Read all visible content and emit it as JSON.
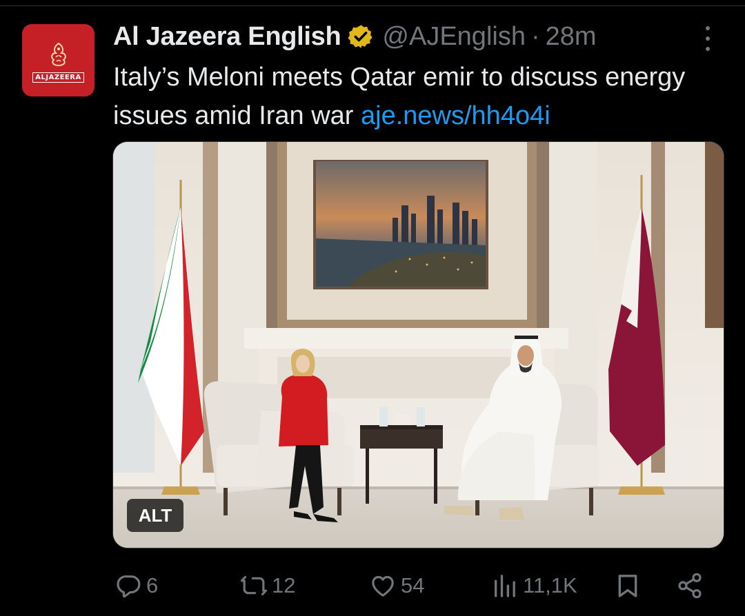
{
  "account": {
    "name": "Al Jazeera English",
    "handle": "@AJEnglish",
    "separator": "·",
    "time": "28m",
    "avatar_label": "ALJAZEERA",
    "avatar_color": "#c42026",
    "verified_icon": "verified-gold-badge-icon",
    "verified_color": "#e2b719"
  },
  "tweet": {
    "text": "Italy’s Meloni meets Qatar emir to discuss energy issues amid Iran war ",
    "link": "aje.news/hh4o4i",
    "link_color": "#1d9bf0"
  },
  "media": {
    "alt_badge": "ALT"
  },
  "actions": {
    "replies": "6",
    "reposts": "12",
    "likes": "54",
    "views": "11,1K"
  },
  "icons": {
    "reply": "reply-bubble-icon",
    "repost": "repost-arrows-icon",
    "like": "heart-icon",
    "views": "views-bar-chart-icon",
    "bookmark": "bookmark-icon",
    "share": "share-icon",
    "more": "more-vertical-icon"
  }
}
